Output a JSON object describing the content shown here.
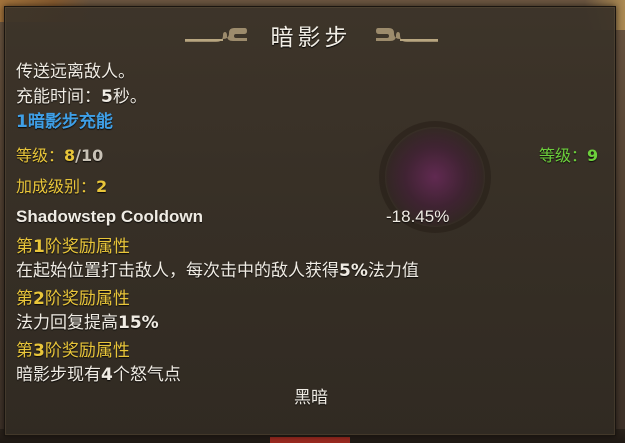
{
  "tooltip": {
    "title": "暗影步",
    "description_line1": "传送远离敌人。",
    "cooldown_label": "充能时间：",
    "cooldown_value": "5",
    "cooldown_unit": "秒。",
    "charges": "1暗影步充能",
    "level_label": "等级：",
    "level_current": "8",
    "level_max": "/10",
    "level_right_label": "等级：",
    "level_right_value": "9",
    "bonus_rank_label": "加成级别：",
    "bonus_rank_value": "2",
    "stat_name": "Shadowstep Cooldown",
    "stat_value": "-18.45%",
    "tiers": [
      {
        "label_prefix": "第",
        "label_num": "1",
        "label_suffix": "阶奖励属性",
        "desc_a": "在起始位置打击敌人，每次击中的敌人获得",
        "desc_num": "5%",
        "desc_b": "法力值"
      },
      {
        "label_prefix": "第",
        "label_num": "2",
        "label_suffix": "阶奖励属性",
        "desc_a": "法力回复提高",
        "desc_num": "15%",
        "desc_b": ""
      },
      {
        "label_prefix": "第",
        "label_num": "3",
        "label_suffix": "阶奖励属性",
        "desc_a": "暗影步现有",
        "desc_num": "4",
        "desc_b": "个怒气点"
      }
    ],
    "footer_tag": "黑暗"
  },
  "colors": {
    "charges_blue": "#3f9fe6",
    "gold": "#e8c53a",
    "green": "#6ccf3c",
    "text": "#f0ece4"
  }
}
